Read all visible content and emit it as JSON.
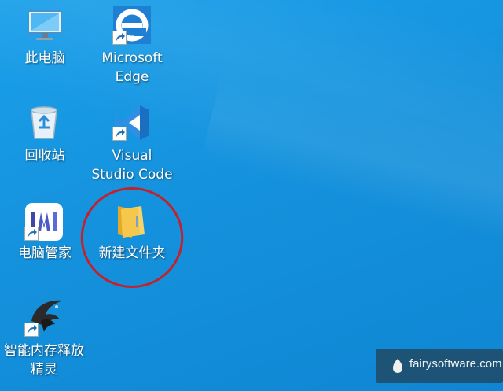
{
  "desktop": {
    "icons": [
      {
        "id": "this-pc",
        "label": "此电脑",
        "icon": "computer-icon",
        "shortcut": false
      },
      {
        "id": "edge",
        "label_line1": "Microsoft",
        "label_line2": "Edge",
        "icon": "edge-icon",
        "shortcut": true
      },
      {
        "id": "recycle-bin",
        "label": "回收站",
        "icon": "recycle-bin-icon",
        "shortcut": false
      },
      {
        "id": "vscode",
        "label_line1": "Visual",
        "label_line2": "Studio Code",
        "icon": "vscode-icon",
        "shortcut": true
      },
      {
        "id": "pc-manager",
        "label": "电脑管家",
        "icon": "pc-manager-icon",
        "shortcut": true
      },
      {
        "id": "new-folder",
        "label": "新建文件夹",
        "icon": "folder-icon",
        "shortcut": false,
        "highlighted": true
      },
      {
        "id": "memory-cleaner",
        "label_line1": "智能内存释放",
        "label_line2": "精灵",
        "icon": "memory-cleaner-icon",
        "shortcut": true
      }
    ]
  },
  "watermark": {
    "text": "fairysoftware.com"
  },
  "colors": {
    "desktop": "#1592dd",
    "highlight_ring": "#c0232e",
    "edge": "#1e7fd3",
    "vscode": "#2f8fe3",
    "folder": "#f5c84b"
  }
}
